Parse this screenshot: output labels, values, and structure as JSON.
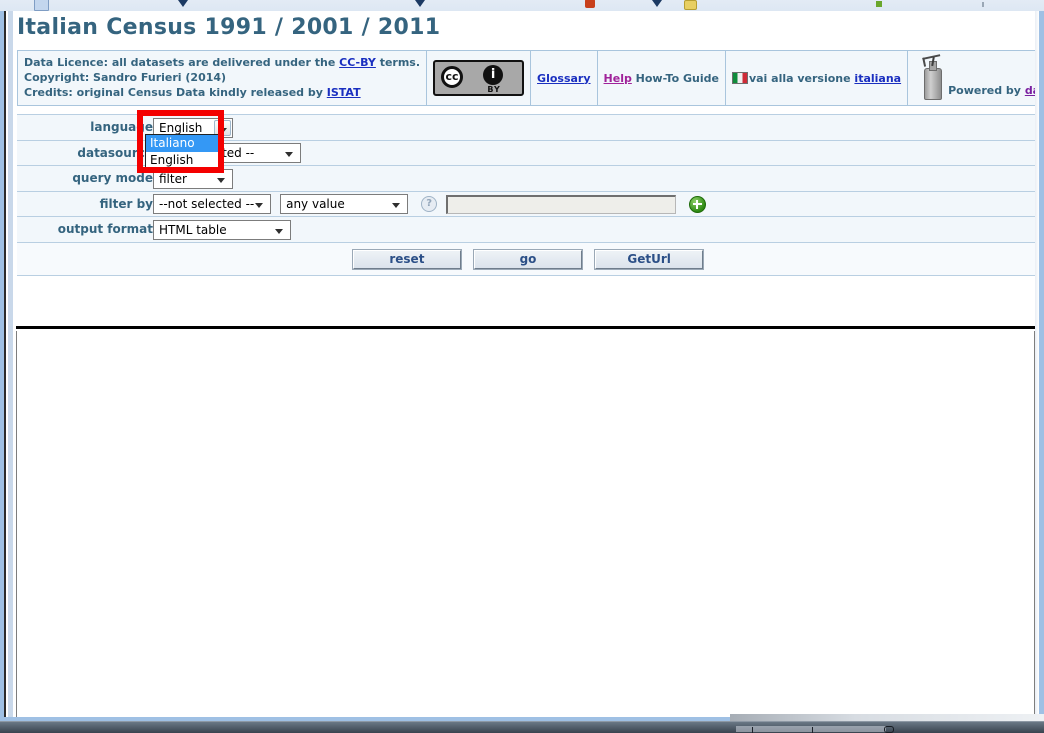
{
  "browser": {
    "bookmark_bar": {
      "icons": [
        "folder-icon",
        "caret-icon",
        "caret-icon",
        "caret-icon",
        "red-favicon",
        "yellow-folder-icon",
        "green-dot-icon",
        "tick-icon"
      ]
    }
  },
  "header": {
    "title": "Italian Census 1991 / 2001 / 2011"
  },
  "credits": {
    "licence_prefix": "Data Licence: all datasets are delivered under the ",
    "licence_link": "CC-BY",
    "licence_suffix": " terms.",
    "copyright": "Copyright: Sandro Furieri (2014)",
    "credits_prefix": "Credits: original Census Data kindly released by ",
    "credits_link": "ISTAT",
    "cc_badge": {
      "cc_text": "cc",
      "info_text": "i",
      "by_text": "BY"
    },
    "glossary_link": "Glossary",
    "help_link": "Help",
    "howto_text": " How-To Guide",
    "italian_prefix": "vai alla versione ",
    "italian_link": "italiana",
    "powered_prefix": "Powered by ",
    "powered_link": "dataSeltzer"
  },
  "form": {
    "language": {
      "label": "language",
      "value": "English",
      "open": true,
      "options": [
        "Italiano",
        "English"
      ],
      "highlighted_option": "Italiano"
    },
    "datasource": {
      "label": "datasource",
      "value": "--not selected --"
    },
    "query_mode": {
      "label": "query mode",
      "value": "filter"
    },
    "filter_by": {
      "label": "filter by",
      "field_value": "--not selected --",
      "operator_value": "any value",
      "help_icon": "question-mark-icon",
      "value_input": "",
      "add_icon": "plus-icon"
    },
    "output_format": {
      "label": "output format",
      "value": "HTML table"
    },
    "buttons": {
      "reset": "reset",
      "go": "go",
      "geturl": "GetUrl"
    }
  },
  "annotation": {
    "highlight_color": "#f40000",
    "target": "language-select"
  },
  "colors": {
    "title": "#35647f",
    "label": "#35647f",
    "link": "#1a2fc0",
    "help_link": "#a0229a",
    "seltzer_link": "#7a1fa0",
    "row_bg": "#f2f7fb",
    "row_border": "#b9cfe2",
    "frame": "#9fc0e4",
    "option_highlight": "#3498f5",
    "button_text": "#2b4f87"
  }
}
